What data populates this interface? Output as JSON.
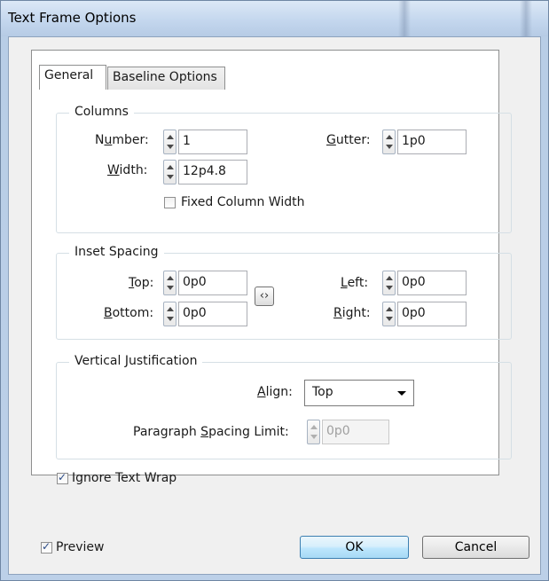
{
  "window": {
    "title": "Text Frame Options"
  },
  "tabs": [
    {
      "label": "General"
    },
    {
      "label": "Baseline Options"
    }
  ],
  "columns": {
    "group_title": "Columns",
    "number_label_pre": "N",
    "number_label_u": "u",
    "number_label_post": "mber:",
    "number_value": "1",
    "gutter_label_u": "G",
    "gutter_label_post": "utter:",
    "gutter_value": "1p0",
    "width_label_u": "W",
    "width_label_post": "idth:",
    "width_value": "12p4.8",
    "fixed_width_label": "Fixed Column Width",
    "fixed_width_checked": false
  },
  "inset": {
    "group_title": "Inset Spacing",
    "top_label_u": "T",
    "top_label_post": "op:",
    "top_value": "0p0",
    "bottom_label_u": "B",
    "bottom_label_post": "ottom:",
    "bottom_value": "0p0",
    "left_label_u": "L",
    "left_label_post": "eft:",
    "left_value": "0p0",
    "right_label_u": "R",
    "right_label_post": "ight:",
    "right_value": "0p0",
    "link_icon": "chain-link-icon"
  },
  "vertical": {
    "group_title": "Vertical Justification",
    "align_label_u": "A",
    "align_label_post": "lign:",
    "align_value": "Top",
    "spacing_label_pre": "Paragraph ",
    "spacing_label_u": "S",
    "spacing_label_post": "pacing Limit:",
    "spacing_value": "0p0"
  },
  "ignore_wrap": {
    "label": "Ignore Text Wrap",
    "checked": true
  },
  "footer": {
    "preview_label": "Preview",
    "preview_checked": true,
    "ok_label": "OK",
    "cancel_label": "Cancel"
  }
}
